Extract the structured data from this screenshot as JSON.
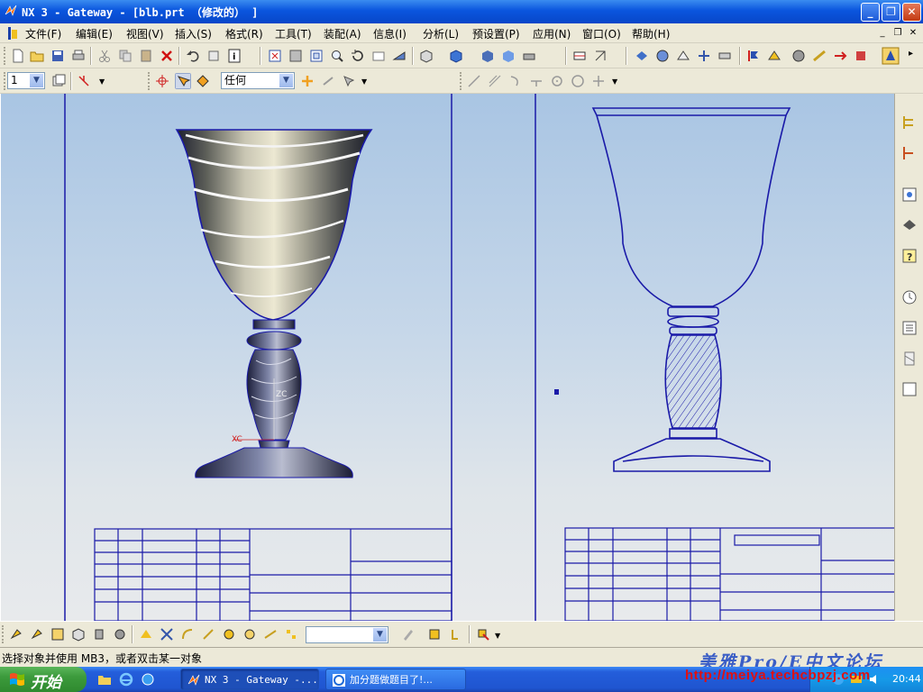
{
  "window": {
    "title": "NX 3 - Gateway - [blb.prt （修改的） ]"
  },
  "menubar": {
    "items": [
      {
        "label": "文件(F)"
      },
      {
        "label": "编辑(E)"
      },
      {
        "label": "视图(V)"
      },
      {
        "label": "插入(S)"
      },
      {
        "label": "格式(R)"
      },
      {
        "label": "工具(T)"
      },
      {
        "label": "装配(A)"
      },
      {
        "label": "信息(I)"
      },
      {
        "label": "分析(L)"
      },
      {
        "label": "预设置(P)"
      },
      {
        "label": "应用(N)"
      },
      {
        "label": "窗口(O)"
      },
      {
        "label": "帮助(H)"
      }
    ]
  },
  "toolbar2": {
    "layer_value": "1",
    "filter_value": "任何"
  },
  "canvas": {
    "axis_xc": "XC",
    "axis_zc": "ZC"
  },
  "status": {
    "prompt": "选择对象并使用 MB3，或者双击某一对象",
    "watermark_text": "美雅Pro/E中文论坛",
    "watermark_url": "http://meiya.techcbpzj.com"
  },
  "taskbar": {
    "start_label": "开始",
    "tasks": [
      {
        "label": "NX 3 - Gateway -..."
      },
      {
        "label": "加分题做题目了!..."
      }
    ],
    "clock": "20:44"
  },
  "colors": {
    "title_blue": "#0a55de",
    "drawing_line": "#1a1aa8",
    "canvas_top": "#a9c5e3",
    "canvas_bottom": "#e8eaec",
    "watermark_blue": "#3b5ec6",
    "watermark_red": "#e01010"
  }
}
